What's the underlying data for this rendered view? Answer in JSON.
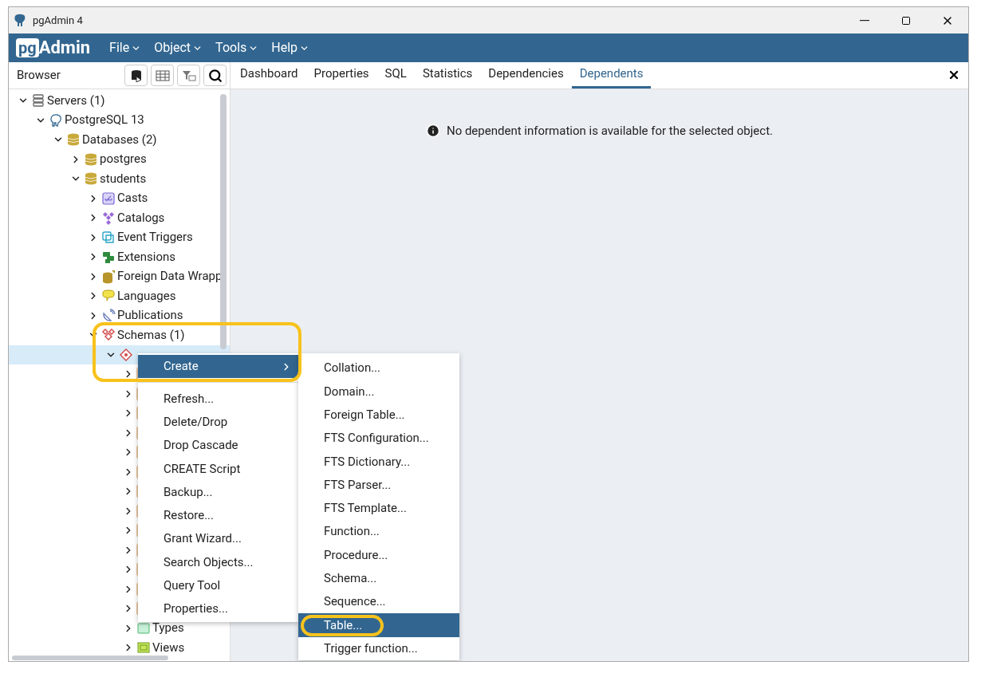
{
  "window": {
    "title": "pgAdmin 4"
  },
  "app": {
    "logo_left": "pg",
    "logo_right": "Admin"
  },
  "menus": [
    {
      "label": "File"
    },
    {
      "label": "Object"
    },
    {
      "label": "Tools"
    },
    {
      "label": "Help"
    }
  ],
  "browser": {
    "title": "Browser",
    "tree": [
      {
        "label": "Servers (1)",
        "kind": "servers",
        "expanded": true,
        "selected": false,
        "children": [
          {
            "label": "PostgreSQL 13",
            "kind": "server",
            "expanded": true,
            "selected": false,
            "children": [
              {
                "label": "Databases (2)",
                "kind": "database",
                "expanded": true,
                "selected": false,
                "children": [
                  {
                    "label": "postgres",
                    "kind": "database",
                    "expanded": false,
                    "selected": false
                  },
                  {
                    "label": "students",
                    "kind": "database",
                    "expanded": true,
                    "selected": false,
                    "children": [
                      {
                        "label": "Casts",
                        "kind": "cast",
                        "expanded": false,
                        "selected": false
                      },
                      {
                        "label": "Catalogs",
                        "kind": "catalog",
                        "expanded": false,
                        "selected": false
                      },
                      {
                        "label": "Event Triggers",
                        "kind": "trigger",
                        "expanded": false,
                        "selected": false
                      },
                      {
                        "label": "Extensions",
                        "kind": "extension",
                        "expanded": false,
                        "selected": false
                      },
                      {
                        "label": "Foreign Data Wrapp",
                        "kind": "fdw",
                        "expanded": false,
                        "selected": false
                      },
                      {
                        "label": "Languages",
                        "kind": "language",
                        "expanded": false,
                        "selected": false
                      },
                      {
                        "label": "Publications",
                        "kind": "publication",
                        "expanded": false,
                        "selected": false
                      },
                      {
                        "label": "Schemas (1)",
                        "kind": "schemas",
                        "expanded": true,
                        "selected": false,
                        "children": [
                          {
                            "kind": "schema",
                            "expanded": true,
                            "selected": true,
                            "children": [
                              {
                                "kind": "hidden",
                                "expanded": false,
                                "selected": false
                              },
                              {
                                "kind": "hidden",
                                "expanded": false,
                                "selected": false
                              },
                              {
                                "kind": "hidden",
                                "expanded": false,
                                "selected": false
                              },
                              {
                                "kind": "hidden",
                                "expanded": false,
                                "selected": false
                              },
                              {
                                "kind": "hidden",
                                "expanded": false,
                                "selected": false
                              },
                              {
                                "kind": "hidden",
                                "expanded": false,
                                "selected": false
                              },
                              {
                                "kind": "hidden",
                                "expanded": false,
                                "selected": false
                              },
                              {
                                "kind": "hidden",
                                "expanded": false,
                                "selected": false
                              },
                              {
                                "kind": "hidden",
                                "expanded": false,
                                "selected": false
                              },
                              {
                                "kind": "hidden",
                                "expanded": false,
                                "selected": false
                              },
                              {
                                "kind": "hidden",
                                "expanded": false,
                                "selected": false
                              },
                              {
                                "kind": "hidden",
                                "expanded": false,
                                "selected": false
                              },
                              {
                                "kind": "hidden",
                                "expanded": false,
                                "selected": false
                              },
                              {
                                "label": "Types",
                                "kind": "types",
                                "expanded": false,
                                "selected": false
                              },
                              {
                                "label": "Views",
                                "kind": "views",
                                "expanded": false,
                                "selected": false
                              }
                            ]
                          }
                        ]
                      }
                    ]
                  }
                ]
              }
            ]
          }
        ]
      }
    ]
  },
  "tabs": [
    {
      "label": "Dashboard",
      "selected": false
    },
    {
      "label": "Properties",
      "selected": false
    },
    {
      "label": "SQL",
      "selected": false
    },
    {
      "label": "Statistics",
      "selected": false
    },
    {
      "label": "Dependencies",
      "selected": false
    },
    {
      "label": "Dependents",
      "selected": true
    }
  ],
  "message": "No dependent information is available for the selected object.",
  "context_menu": [
    {
      "label": "Create",
      "kind": "submenu",
      "selected": true
    },
    {
      "kind": "separator"
    },
    {
      "label": "Refresh...",
      "kind": "item",
      "selected": false
    },
    {
      "label": "Delete/Drop",
      "kind": "item",
      "selected": false
    },
    {
      "label": "Drop Cascade",
      "kind": "item",
      "selected": false
    },
    {
      "label": "CREATE Script",
      "kind": "item",
      "selected": false
    },
    {
      "label": "Backup...",
      "kind": "item",
      "selected": false
    },
    {
      "label": "Restore...",
      "kind": "item",
      "selected": false
    },
    {
      "label": "Grant Wizard...",
      "kind": "item",
      "selected": false
    },
    {
      "label": "Search Objects...",
      "kind": "item",
      "selected": false
    },
    {
      "label": "Query Tool",
      "kind": "item",
      "selected": false
    },
    {
      "label": "Properties...",
      "kind": "item",
      "selected": false
    }
  ],
  "submenu": [
    {
      "label": "Collation...",
      "selected": false
    },
    {
      "label": "Domain...",
      "selected": false
    },
    {
      "label": "Foreign Table...",
      "selected": false
    },
    {
      "label": "FTS Configuration...",
      "selected": false
    },
    {
      "label": "FTS Dictionary...",
      "selected": false
    },
    {
      "label": "FTS Parser...",
      "selected": false
    },
    {
      "label": "FTS Template...",
      "selected": false
    },
    {
      "label": "Function...",
      "selected": false
    },
    {
      "label": "Procedure...",
      "selected": false
    },
    {
      "label": "Schema...",
      "selected": false
    },
    {
      "label": "Sequence...",
      "selected": false
    },
    {
      "label": "Table...",
      "selected": true
    },
    {
      "label": "Trigger function...",
      "selected": false
    }
  ]
}
